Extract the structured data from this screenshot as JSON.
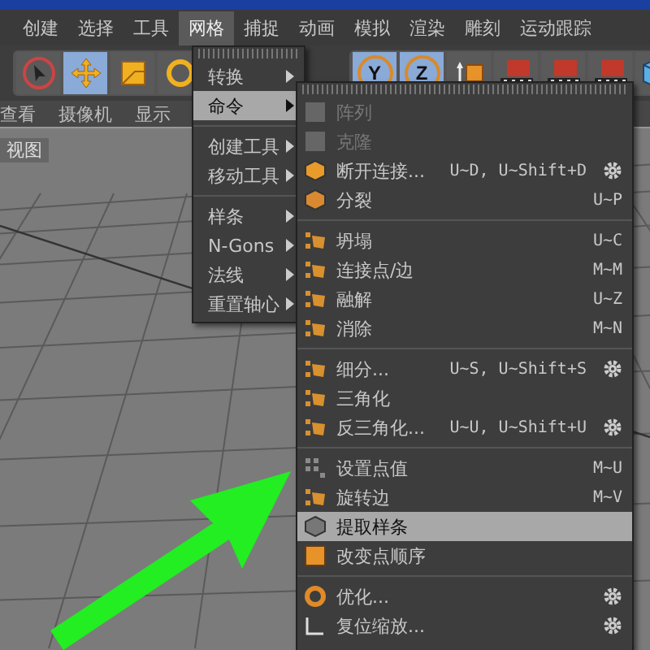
{
  "menubar": [
    {
      "label": "创建",
      "selected": false
    },
    {
      "label": "选择",
      "selected": false
    },
    {
      "label": "工具",
      "selected": false
    },
    {
      "label": "网格",
      "selected": true
    },
    {
      "label": "捕捉",
      "selected": false
    },
    {
      "label": "动画",
      "selected": false
    },
    {
      "label": "模拟",
      "selected": false
    },
    {
      "label": "渲染",
      "selected": false
    },
    {
      "label": "雕刻",
      "selected": false
    },
    {
      "label": "运动跟踪",
      "selected": false
    }
  ],
  "toolbar_left": [
    {
      "kind": "select",
      "selected": false
    },
    {
      "kind": "move",
      "selected": true
    },
    {
      "kind": "scale",
      "selected": false
    },
    {
      "kind": "rotate",
      "selected": false
    }
  ],
  "toolbar_right": [
    {
      "kind": "axis",
      "label": "Y",
      "selected": true
    },
    {
      "kind": "axis",
      "label": "Z",
      "selected": true
    },
    {
      "kind": "coord",
      "selected": false
    },
    {
      "kind": "render",
      "selected": false
    },
    {
      "kind": "render",
      "selected": false
    },
    {
      "kind": "render",
      "selected": false
    },
    {
      "kind": "cube",
      "selected": false
    }
  ],
  "viewport_menu": [
    "查看",
    "摄像机",
    "显示"
  ],
  "viewport_label": "视图",
  "mesh_menu": [
    [
      {
        "label": "转换",
        "selected": false
      },
      {
        "label": "命令",
        "selected": true
      }
    ],
    [
      {
        "label": "创建工具",
        "selected": false
      },
      {
        "label": "移动工具",
        "selected": false
      }
    ],
    [
      {
        "label": "样条",
        "selected": false
      },
      {
        "label": "N-Gons",
        "selected": false
      },
      {
        "label": "法线",
        "selected": false
      },
      {
        "label": "重置轴心",
        "selected": false
      }
    ]
  ],
  "commands_menu": [
    [
      {
        "kind": "grid",
        "label": "阵列",
        "options": false,
        "disabled": true,
        "selected": false
      },
      {
        "kind": "clone",
        "label": "克隆",
        "options": false,
        "disabled": true,
        "selected": false
      },
      {
        "kind": "cube",
        "label": "断开连接...",
        "shortcut": "U~D, U~Shift+D",
        "options": true,
        "disabled": false,
        "selected": false
      },
      {
        "kind": "split",
        "label": "分裂",
        "shortcut": "U~P",
        "options": false,
        "disabled": false,
        "selected": false
      }
    ],
    [
      {
        "kind": "poly",
        "label": "坍塌",
        "shortcut": "U~C",
        "options": false,
        "disabled": false,
        "selected": false
      },
      {
        "kind": "poly",
        "label": "连接点/边",
        "shortcut": "M~M",
        "options": false,
        "disabled": false,
        "selected": false
      },
      {
        "kind": "poly",
        "label": "融解",
        "shortcut": "U~Z",
        "options": false,
        "disabled": false,
        "selected": false
      },
      {
        "kind": "poly",
        "label": "消除",
        "shortcut": "M~N",
        "options": false,
        "disabled": false,
        "selected": false
      }
    ],
    [
      {
        "kind": "poly",
        "label": "细分...",
        "shortcut": "U~S, U~Shift+S",
        "options": true,
        "disabled": false,
        "selected": false
      },
      {
        "kind": "poly",
        "label": "三角化",
        "options": false,
        "disabled": false,
        "selected": false
      },
      {
        "kind": "poly",
        "label": "反三角化...",
        "shortcut": "U~U, U~Shift+U",
        "options": true,
        "disabled": false,
        "selected": false
      }
    ],
    [
      {
        "kind": "points",
        "label": "设置点值",
        "shortcut": "M~U",
        "options": false,
        "disabled": false,
        "selected": false
      },
      {
        "kind": "poly",
        "label": "旋转边",
        "shortcut": "M~V",
        "options": false,
        "disabled": false,
        "selected": false
      },
      {
        "kind": "box",
        "label": "提取样条",
        "options": false,
        "disabled": false,
        "selected": true
      },
      {
        "kind": "order",
        "label": "改变点顺序",
        "options": false,
        "disabled": false,
        "selected": false
      }
    ],
    [
      {
        "kind": "recycle",
        "label": "优化...",
        "options": true,
        "disabled": false,
        "selected": false
      },
      {
        "kind": "scale",
        "label": "复位缩放...",
        "options": true,
        "disabled": false,
        "selected": false
      }
    ]
  ]
}
